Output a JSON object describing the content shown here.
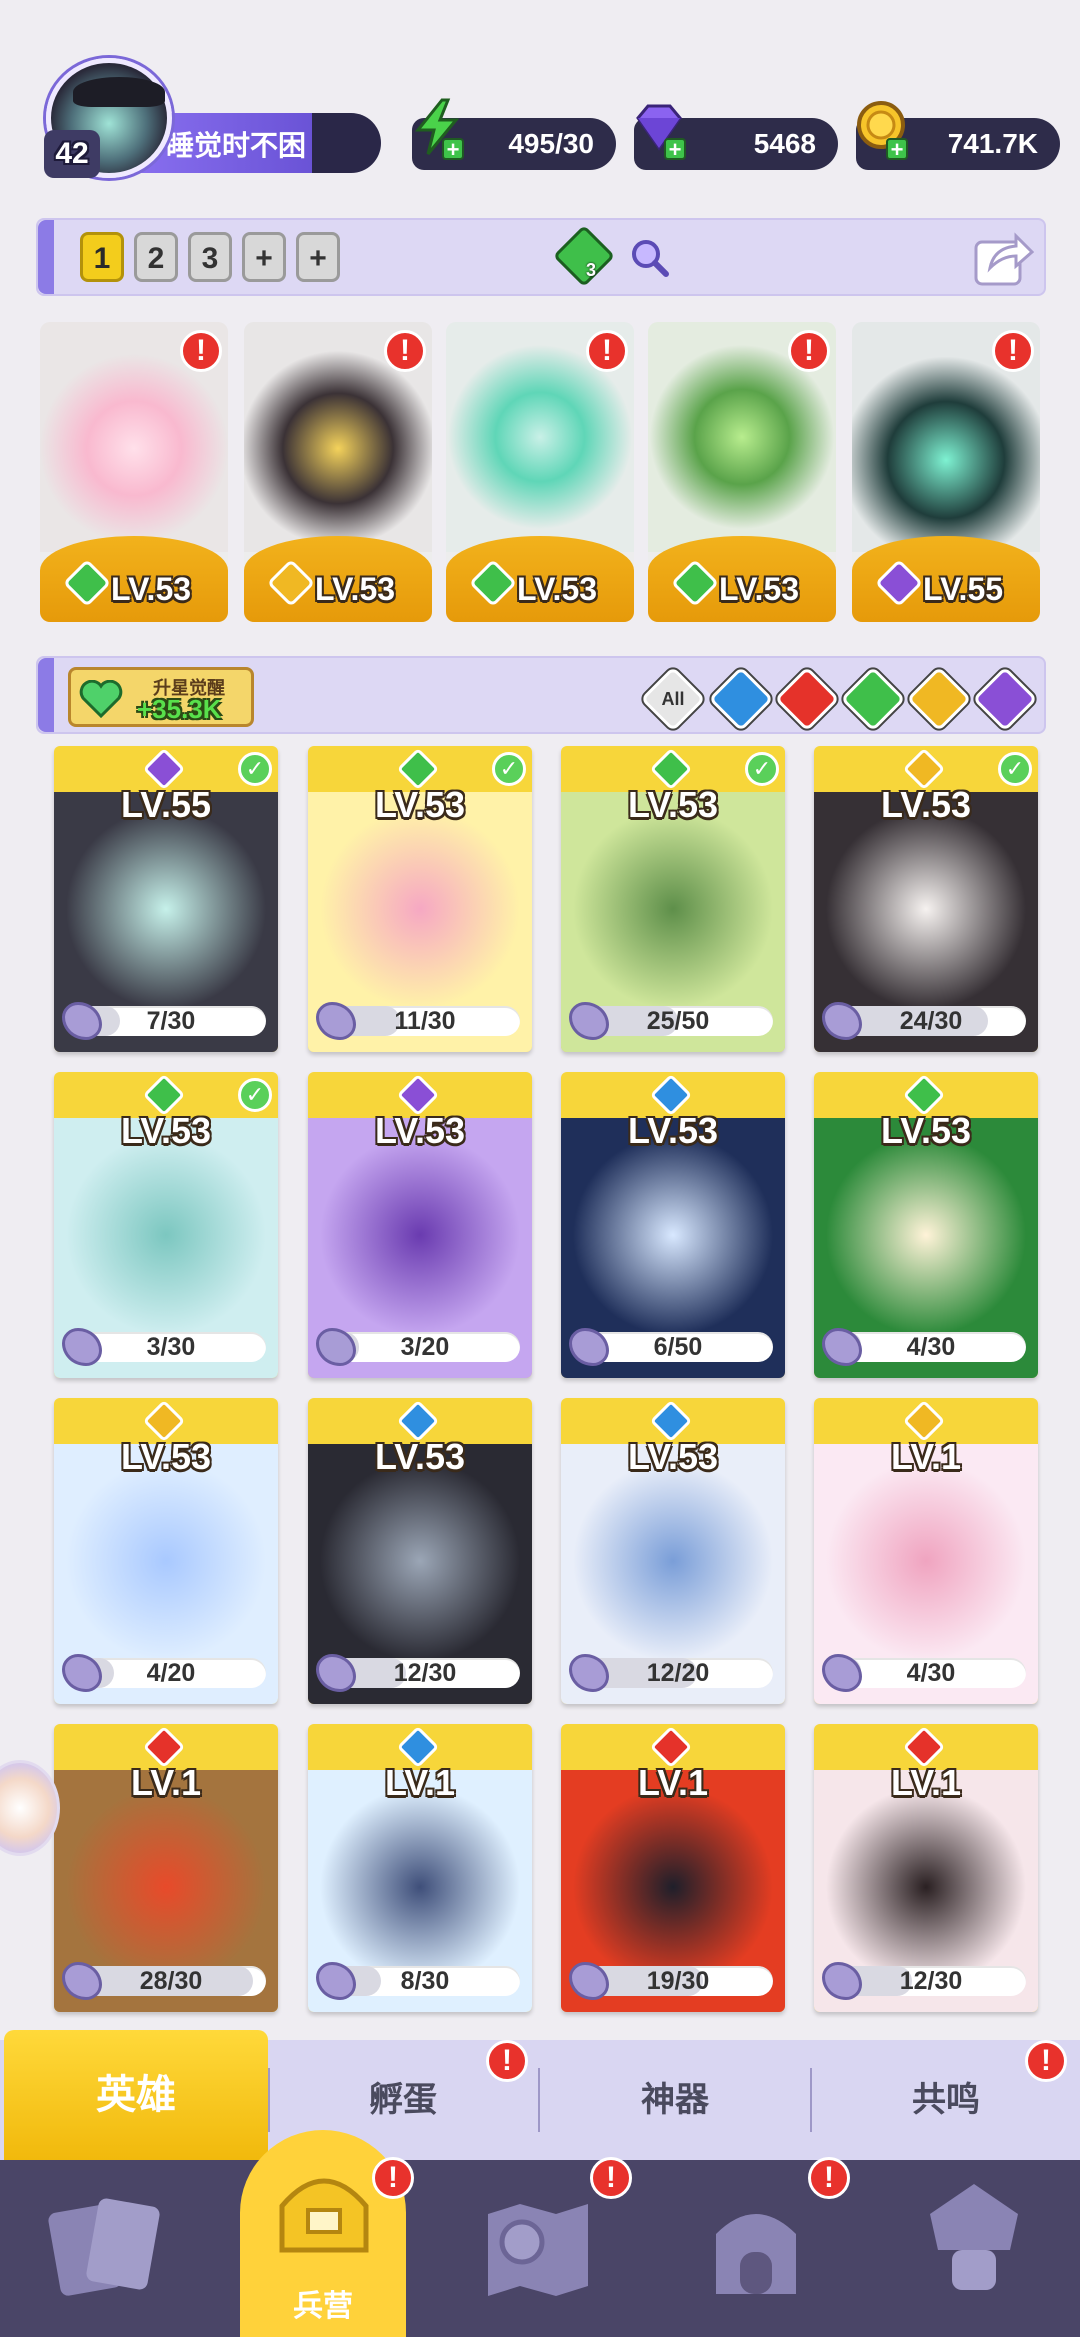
{
  "player": {
    "level": "42",
    "name": "睡觉时不困"
  },
  "resources": {
    "energy": "495/30",
    "gems": "5468",
    "gold": "741.7K"
  },
  "team_slots": [
    "1",
    "2",
    "3",
    "+",
    "+"
  ],
  "team_gem_count": "3",
  "featured": [
    {
      "level": "LV.53",
      "element": "nature",
      "color": "#3fbf4a"
    },
    {
      "level": "LV.53",
      "element": "light",
      "color": "#f0b823"
    },
    {
      "level": "LV.53",
      "element": "nature",
      "color": "#3fbf4a"
    },
    {
      "level": "LV.53",
      "element": "nature",
      "color": "#3fbf4a"
    },
    {
      "level": "LV.55",
      "element": "dark",
      "color": "#8a4fd6"
    }
  ],
  "star_up": {
    "label": "升星觉醒",
    "value": "+35.3K"
  },
  "filters": {
    "all_label": "All",
    "elements": [
      "water",
      "fire",
      "nature",
      "light",
      "dark"
    ]
  },
  "heroes": [
    {
      "level": "LV.55",
      "element": "dark",
      "shards": "7/30",
      "progress": 0.23,
      "checked": true
    },
    {
      "level": "LV.53",
      "element": "nature",
      "shards": "11/30",
      "progress": 0.37,
      "checked": true
    },
    {
      "level": "LV.53",
      "element": "nature",
      "shards": "25/50",
      "progress": 0.5,
      "checked": true
    },
    {
      "level": "LV.53",
      "element": "light",
      "shards": "24/30",
      "progress": 0.8,
      "checked": true
    },
    {
      "level": "LV.53",
      "element": "nature",
      "shards": "3/30",
      "progress": 0.1,
      "checked": true
    },
    {
      "level": "LV.53",
      "element": "dark",
      "shards": "3/20",
      "progress": 0.15,
      "checked": false
    },
    {
      "level": "LV.53",
      "element": "water",
      "shards": "6/50",
      "progress": 0.12,
      "checked": false
    },
    {
      "level": "LV.53",
      "element": "nature",
      "shards": "4/30",
      "progress": 0.13,
      "checked": false
    },
    {
      "level": "LV.53",
      "element": "light",
      "shards": "4/20",
      "progress": 0.2,
      "checked": false
    },
    {
      "level": "LV.53",
      "element": "water",
      "shards": "12/30",
      "progress": 0.4,
      "checked": false
    },
    {
      "level": "LV.53",
      "element": "water",
      "shards": "12/20",
      "progress": 0.6,
      "checked": false
    },
    {
      "level": "LV.1",
      "element": "light",
      "shards": "4/30",
      "progress": 0.13,
      "checked": false
    },
    {
      "level": "LV.1",
      "element": "fire",
      "shards": "28/30",
      "progress": 0.93,
      "checked": false
    },
    {
      "level": "LV.1",
      "element": "water",
      "shards": "8/30",
      "progress": 0.27,
      "checked": false
    },
    {
      "level": "LV.1",
      "element": "fire",
      "shards": "19/30",
      "progress": 0.63,
      "checked": false
    },
    {
      "level": "LV.1",
      "element": "fire",
      "shards": "12/30",
      "progress": 0.4,
      "checked": false
    }
  ],
  "element_colors": {
    "nature": "#3fbf4a",
    "light": "#f0b823",
    "dark": "#8a4fd6",
    "water": "#2f8fe0",
    "fire": "#e5322a"
  },
  "tabs": [
    {
      "label": "英雄",
      "active": true,
      "alert": false
    },
    {
      "label": "孵蛋",
      "active": false,
      "alert": true
    },
    {
      "label": "神器",
      "active": false,
      "alert": false
    },
    {
      "label": "共鸣",
      "active": false,
      "alert": true
    }
  ],
  "nav": [
    {
      "name": "cards",
      "label": "",
      "alert": false
    },
    {
      "name": "barracks",
      "label": "兵营",
      "alert": true
    },
    {
      "name": "map",
      "label": "",
      "alert": true
    },
    {
      "name": "castle",
      "label": "",
      "alert": true
    },
    {
      "name": "mushroom",
      "label": "",
      "alert": false
    }
  ],
  "alert_mark": "!",
  "check_mark": "✓"
}
